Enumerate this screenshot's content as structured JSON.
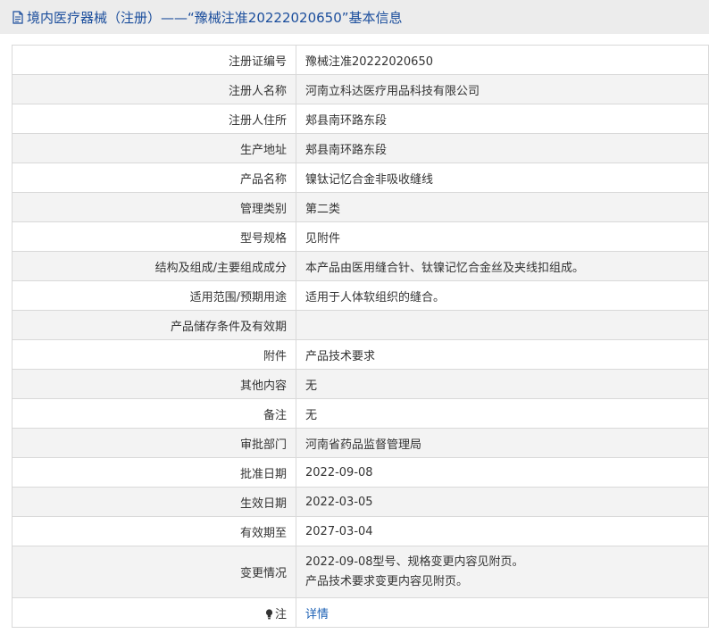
{
  "header": {
    "title": "境内医疗器械（注册）——“豫械注准20222020650”基本信息"
  },
  "rows": [
    {
      "label": "注册证编号",
      "value": "豫械注准20222020650"
    },
    {
      "label": "注册人名称",
      "value": "河南立科达医疗用品科技有限公司"
    },
    {
      "label": "注册人住所",
      "value": "郏县南环路东段"
    },
    {
      "label": "生产地址",
      "value": "郏县南环路东段"
    },
    {
      "label": "产品名称",
      "value": "镍钛记忆合金非吸收缝线"
    },
    {
      "label": "管理类别",
      "value": "第二类"
    },
    {
      "label": "型号规格",
      "value": "见附件"
    },
    {
      "label": "结构及组成/主要组成成分",
      "value": "本产品由医用缝合针、钛镍记忆合金丝及夹线扣组成。"
    },
    {
      "label": "适用范围/预期用途",
      "value": "适用于人体软组织的缝合。"
    },
    {
      "label": "产品储存条件及有效期",
      "value": ""
    },
    {
      "label": "附件",
      "value": "产品技术要求"
    },
    {
      "label": "其他内容",
      "value": "无"
    },
    {
      "label": "备注",
      "value": "无"
    },
    {
      "label": "审批部门",
      "value": "河南省药品监督管理局"
    },
    {
      "label": "批准日期",
      "value": "2022-09-08"
    },
    {
      "label": "生效日期",
      "value": "2022-03-05"
    },
    {
      "label": "有效期至",
      "value": "2027-03-04"
    }
  ],
  "change": {
    "label": "变更情况",
    "line1": "2022-09-08型号、规格变更内容见附页。",
    "line2": "产品技术要求变更内容见附页。"
  },
  "note": {
    "label": "注",
    "link_text": "详情",
    "icon": "lightbulb-icon"
  }
}
